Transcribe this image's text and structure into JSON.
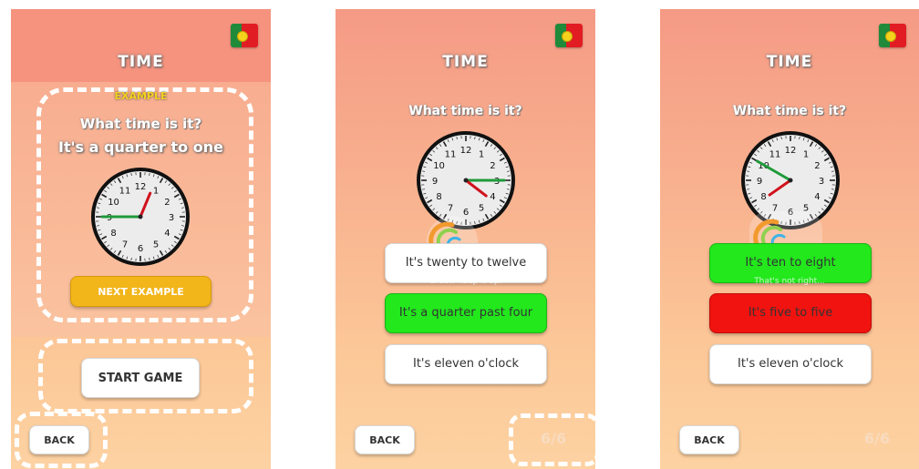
{
  "screens": [
    {
      "title": "TIME",
      "flag_icon": "portugal-flag-icon",
      "example_label": "EXAMPLE",
      "question": "What time is it?",
      "answer": "It's a quarter to one",
      "next_example": "NEXT EXAMPLE",
      "start_game": "START GAME",
      "back": "BACK",
      "clock": {
        "hour": 12,
        "minute": 45
      }
    },
    {
      "title": "TIME",
      "flag_icon": "portugal-flag-icon",
      "question": "What time is it?",
      "clock": {
        "hour": 4,
        "minute": 15
      },
      "feedback": "Great! Keep it up.",
      "answers": [
        {
          "label": "It's twenty to twelve",
          "state": "normal"
        },
        {
          "label": "It's a quarter past four",
          "state": "correct"
        },
        {
          "label": "It's eleven o'clock",
          "state": "normal"
        }
      ],
      "back": "BACK",
      "counter": "6/6"
    },
    {
      "title": "TIME",
      "flag_icon": "portugal-flag-icon",
      "question": "What time is it?",
      "clock": {
        "hour": 7,
        "minute": 50
      },
      "feedback": "That's not right...",
      "answers": [
        {
          "label": "It's ten to eight",
          "state": "correct"
        },
        {
          "label": "It's five to five",
          "state": "wrong"
        },
        {
          "label": "It's eleven o'clock",
          "state": "normal"
        }
      ],
      "back": "BACK",
      "counter": "6/6"
    }
  ],
  "colors": {
    "correct": "#22e81c",
    "wrong": "#f0130f",
    "accent": "#f2b51a",
    "background_top": "#f59a85",
    "background_bottom": "#fdd2a2"
  }
}
